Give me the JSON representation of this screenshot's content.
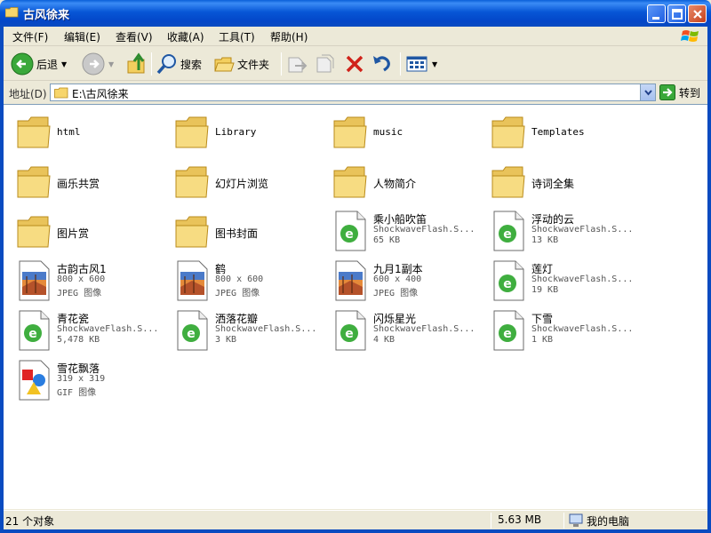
{
  "window": {
    "title": "古风徐来"
  },
  "menu": [
    "文件(F)",
    "编辑(E)",
    "查看(V)",
    "收藏(A)",
    "工具(T)",
    "帮助(H)"
  ],
  "toolbar": {
    "back": "后退",
    "search": "搜索",
    "folders": "文件夹"
  },
  "address": {
    "label": "地址(D)",
    "path": "E:\\古风徐来",
    "go": "转到"
  },
  "items": [
    {
      "type": "folder",
      "name": "html"
    },
    {
      "type": "folder",
      "name": "Library"
    },
    {
      "type": "folder",
      "name": "music"
    },
    {
      "type": "folder",
      "name": "Templates"
    },
    {
      "type": "folder",
      "name": "画乐共赏"
    },
    {
      "type": "folder",
      "name": "幻灯片浏览"
    },
    {
      "type": "folder",
      "name": "人物简介"
    },
    {
      "type": "folder",
      "name": "诗词全集"
    },
    {
      "type": "folder",
      "name": "图片赏"
    },
    {
      "type": "folder",
      "name": "图书封面"
    },
    {
      "type": "swf",
      "name": "乘小船吹笛",
      "line1": "ShockwaveFlash.S...",
      "line2": "65 KB"
    },
    {
      "type": "swf",
      "name": "浮动的云",
      "line1": "ShockwaveFlash.S...",
      "line2": "13 KB"
    },
    {
      "type": "jpeg",
      "name": "古韵古风1",
      "line1": "800 x 600",
      "line2": "JPEG 图像"
    },
    {
      "type": "jpeg",
      "name": "鹤",
      "line1": "800 x 600",
      "line2": "JPEG 图像"
    },
    {
      "type": "jpeg",
      "name": "九月1副本",
      "line1": "600 x 400",
      "line2": "JPEG 图像"
    },
    {
      "type": "swf",
      "name": "莲灯",
      "line1": "ShockwaveFlash.S...",
      "line2": "19 KB"
    },
    {
      "type": "swf",
      "name": "青花瓷",
      "line1": "ShockwaveFlash.S...",
      "line2": "5,478 KB"
    },
    {
      "type": "swf",
      "name": "洒落花瓣",
      "line1": "ShockwaveFlash.S...",
      "line2": "3 KB"
    },
    {
      "type": "swf",
      "name": "闪烁星光",
      "line1": "ShockwaveFlash.S...",
      "line2": "4 KB"
    },
    {
      "type": "swf",
      "name": "下雪",
      "line1": "ShockwaveFlash.S...",
      "line2": "1 KB"
    },
    {
      "type": "gif",
      "name": "雪花飘落",
      "line1": "319 x 319",
      "line2": "GIF 图像"
    }
  ],
  "status": {
    "count": "21 个对象",
    "size": "5.63 MB",
    "location": "我的电脑"
  },
  "colors": {
    "titlebar": "#0346c8",
    "folder": "#f5d878",
    "close": "#c6401c"
  }
}
